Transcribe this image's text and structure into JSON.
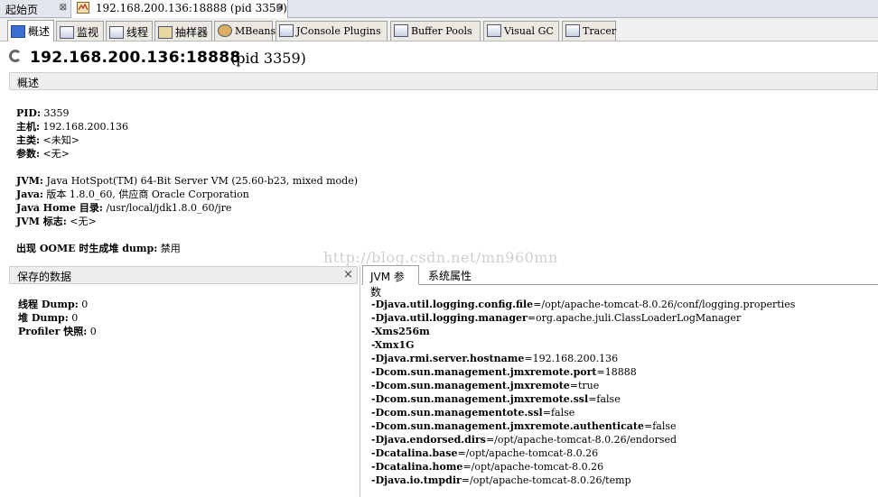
{
  "doc_tabs": [
    {
      "label": "起始页",
      "close": "⊠"
    },
    {
      "label": "192.168.200.136:18888  (pid 3359)",
      "close": "⊠"
    }
  ],
  "view_tabs": [
    "概述",
    "监视",
    "线程",
    "抽样器",
    "MBeans",
    "JConsole Plugins",
    "Buffer Pools",
    "Visual GC",
    "Tracer"
  ],
  "header": {
    "title": "192.168.200.136:18888",
    "pid": "(pid 3359)"
  },
  "overview": {
    "section_label": "概述",
    "lines": [
      {
        "k": "PID:",
        "v": " 3359"
      },
      {
        "k": "主机:",
        "v": " 192.168.200.136"
      },
      {
        "k": "主类:",
        "v": " <未知>"
      },
      {
        "k": "参数:",
        "v": " <无>"
      },
      {
        "k": "",
        "v": ""
      },
      {
        "k": "JVM:",
        "v": " Java HotSpot(TM) 64-Bit Server VM (25.60-b23, mixed mode)"
      },
      {
        "k": "Java:",
        "v": " 版本 1.8.0_60, 供应商 Oracle Corporation"
      },
      {
        "k": "Java Home 目录:",
        "v": " /usr/local/jdk1.8.0_60/jre"
      },
      {
        "k": "JVM 标志:",
        "v": " <无>"
      },
      {
        "k": "",
        "v": ""
      },
      {
        "k": "出现 OOME 时生成堆 dump:",
        "v": " 禁用"
      }
    ]
  },
  "watermark": "http://blog.csdn.net/mn960mn",
  "saved_data": {
    "section_label": "保存的数据",
    "close": "×",
    "lines": [
      {
        "k": "线程 Dump:",
        "v": " 0"
      },
      {
        "k": "堆 Dump:",
        "v": " 0"
      },
      {
        "k": "Profiler 快照:",
        "v": " 0"
      }
    ]
  },
  "right_tabs": [
    "JVM 参数",
    "系统属性"
  ],
  "jvm_args": [
    {
      "k": "-Djava.util.logging.config.file",
      "v": "=/opt/apache-tomcat-8.0.26/conf/logging.properties"
    },
    {
      "k": "-Djava.util.logging.manager",
      "v": "=org.apache.juli.ClassLoaderLogManager"
    },
    {
      "k": "-Xms256m",
      "v": ""
    },
    {
      "k": "-Xmx1G",
      "v": ""
    },
    {
      "k": "-Djava.rmi.server.hostname",
      "v": "=192.168.200.136"
    },
    {
      "k": "-Dcom.sun.management.jmxremote.port",
      "v": "=18888"
    },
    {
      "k": "-Dcom.sun.management.jmxremote",
      "v": "=true"
    },
    {
      "k": "-Dcom.sun.management.jmxremote.ssl",
      "v": "=false"
    },
    {
      "k": "-Dcom.sun.managementote.ssl",
      "v": "=false"
    },
    {
      "k": "-Dcom.sun.management.jmxremote.authenticate",
      "v": "=false"
    },
    {
      "k": "-Djava.endorsed.dirs",
      "v": "=/opt/apache-tomcat-8.0.26/endorsed"
    },
    {
      "k": "-Dcatalina.base",
      "v": "=/opt/apache-tomcat-8.0.26"
    },
    {
      "k": "-Dcatalina.home",
      "v": "=/opt/apache-tomcat-8.0.26"
    },
    {
      "k": "-Djava.io.tmpdir",
      "v": "=/opt/apache-tomcat-8.0.26/temp"
    }
  ]
}
